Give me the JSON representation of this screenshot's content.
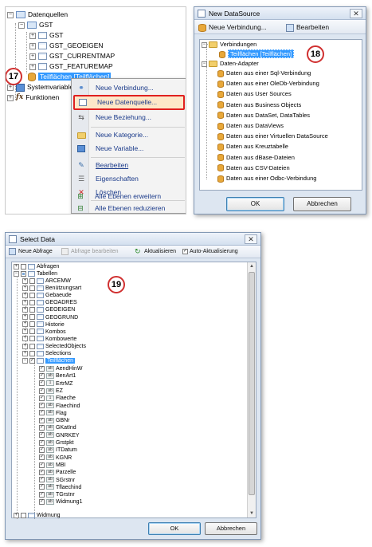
{
  "panel1": {
    "tree": [
      {
        "label": "Datenquellen",
        "icon": "datasources-icon"
      },
      {
        "label": "GST",
        "icon": "datasource-icon"
      },
      {
        "label": "GST",
        "icon": "table-icon"
      },
      {
        "label": "GST_GEOEIGEN",
        "icon": "table-icon"
      },
      {
        "label": "GST_CURRENTMAP",
        "icon": "table-icon"
      },
      {
        "label": "GST_FEATUREMAP",
        "icon": "table-icon"
      },
      {
        "label": "Teilflächen [Teilflächen]",
        "icon": "database-icon"
      },
      {
        "label": "Systemvariablen",
        "icon": "variables-icon"
      },
      {
        "label": "Funktionen",
        "icon": "functions-icon"
      }
    ],
    "badge": "17",
    "context_menu": [
      {
        "label": "Neue Verbindung...",
        "icon": "new-connection-icon"
      },
      {
        "label": "Neue Datenquelle...",
        "icon": "new-datasource-icon"
      },
      {
        "label": "Neue Beziehung...",
        "icon": "new-relation-icon"
      },
      {
        "label": "Neue Kategorie...",
        "icon": "new-category-icon"
      },
      {
        "label": "Neue Variable...",
        "icon": "new-variable-icon"
      },
      {
        "label": "Bearbeiten",
        "icon": "edit-icon"
      },
      {
        "label": "Eigenschaften",
        "icon": "properties-icon"
      },
      {
        "label": "Löschen",
        "icon": "delete-icon"
      },
      {
        "label": "Alle Ebenen erweitern",
        "icon": "expand-all-icon"
      },
      {
        "label": "Alle Ebenen reduzieren",
        "icon": "collapse-all-icon"
      }
    ],
    "highlight_color": "#e02020"
  },
  "panel2": {
    "title": "New DataSource",
    "toolbar": {
      "new_connection": "Neue Verbindung...",
      "edit": "Bearbeiten"
    },
    "connections_label": "Verbindungen",
    "connection_item": "Teilflächen [Teilflächen]",
    "badge": "18",
    "adapters_label": "Daten-Adapter",
    "adapters": [
      "Daten aus einer Sql-Verbindung",
      "Daten aus einer OleDb-Verbindung",
      "Daten aus User Sources",
      "Daten aus Business Objects",
      "Daten aus DataSet, DataTables",
      "Daten aus DataViews",
      "Daten aus einer Virtuellen DataSource",
      "Daten aus Kreuztabelle",
      "Daten aus dBase-Dateien",
      "Daten aus CSV-Dateien",
      "Daten aus einer Odbc-Verbindung"
    ],
    "ok": "OK",
    "cancel": "Abbrechen"
  },
  "panel3": {
    "title": "Select Data",
    "toolbar": {
      "new_query": "Neue Abfrage",
      "edit_query": "Abfrage bearbeiten",
      "refresh": "Aktualisieren",
      "auto_refresh": "Auto-Aktualisierung"
    },
    "badge": "19",
    "root_items": [
      {
        "label": "Abfragen"
      },
      {
        "label": "Tabellen"
      }
    ],
    "tables": [
      "ARCEMW",
      "Benützungsart",
      "Gebaeude",
      "GEOADRES",
      "GEOEIGEN",
      "GEOGRUND",
      "Historie",
      "Kombos",
      "Kombowerte",
      "SelectedObjects",
      "Selections",
      "Teilflächen"
    ],
    "fields": [
      {
        "label": "AendHinW",
        "type": "ab"
      },
      {
        "label": "BenArt1",
        "type": "ab"
      },
      {
        "label": "ErtrMZ",
        "type": "1"
      },
      {
        "label": "EZ",
        "type": "ab"
      },
      {
        "label": "Flaeche",
        "type": "1"
      },
      {
        "label": "Flaechind",
        "type": "ab"
      },
      {
        "label": "Flag",
        "type": "ab"
      },
      {
        "label": "GBNr",
        "type": "ab"
      },
      {
        "label": "GKatInd",
        "type": "ab"
      },
      {
        "label": "GNRKEY",
        "type": "ab"
      },
      {
        "label": "Grstpkt",
        "type": "ab"
      },
      {
        "label": "ITDatum",
        "type": "ab"
      },
      {
        "label": "KGNR",
        "type": "ab"
      },
      {
        "label": "MBI",
        "type": "ab"
      },
      {
        "label": "Parzelle",
        "type": "ab"
      },
      {
        "label": "SGrstnr",
        "type": "ab"
      },
      {
        "label": "Tflaechind",
        "type": "ab"
      },
      {
        "label": "TGrstnr",
        "type": "ab"
      },
      {
        "label": "Widmung1",
        "type": "ab"
      }
    ],
    "last_partial": "Widmung",
    "ok": "OK",
    "cancel": "Abbrechen"
  }
}
